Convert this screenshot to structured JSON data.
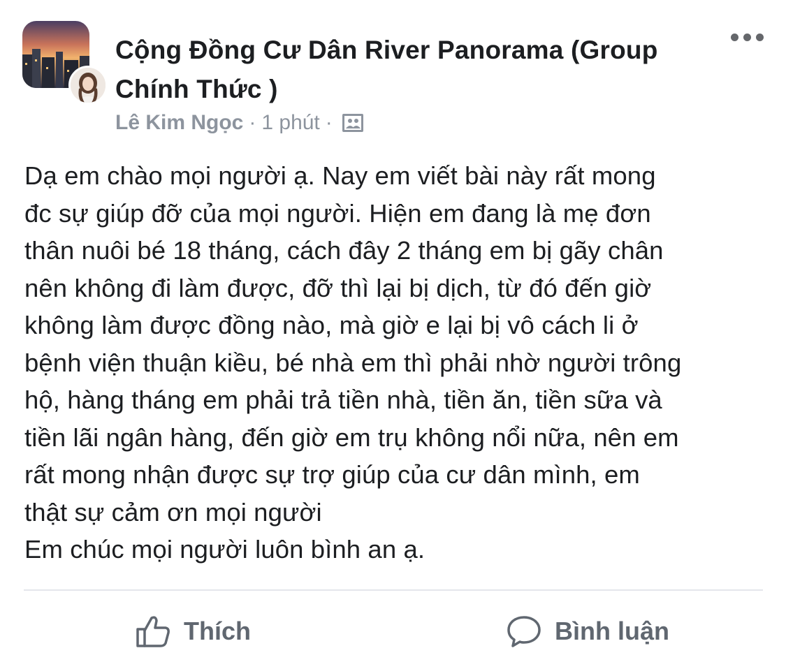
{
  "post": {
    "group_name": "Cộng Đồng Cư Dân River Panorama (Group Chính Thức )",
    "author": "Lê Kim Ngọc",
    "separator": "·",
    "time": "1 phút",
    "audience_icon": "members-icon",
    "more_icon": "more-icon",
    "body_lines": [
      "Dạ em chào mọi người ạ. Nay em viết bài này rất mong",
      "đc sự giúp đỡ của mọi người. Hiện em đang là mẹ đơn",
      "thân nuôi bé 18 tháng, cách đây 2 tháng em bị gãy chân",
      "nên không đi làm được, đỡ thì lại bị dịch, từ đó đến giờ",
      "không làm được đồng nào, mà giờ e lại bị vô cách li ở",
      "bệnh viện thuận kiều, bé nhà em thì phải nhờ người trông",
      "hộ, hàng tháng em phải trả tiền nhà, tiền ăn, tiền sữa và",
      "tiền lãi ngân hàng, đến giờ em trụ không nổi nữa, nên em",
      "rất mong nhận được sự trợ giúp của cư dân mình, em",
      "thật sự cảm ơn mọi người",
      "Em chúc mọi người luôn bình an ạ."
    ]
  },
  "actions": {
    "like_label": "Thích",
    "like_icon": "thumbs-up-icon",
    "comment_label": "Bình luận",
    "comment_icon": "comment-icon"
  },
  "colors": {
    "text": "#1c1e21",
    "meta": "#8d949e",
    "action": "#606770",
    "divider": "#e4e6eb"
  }
}
